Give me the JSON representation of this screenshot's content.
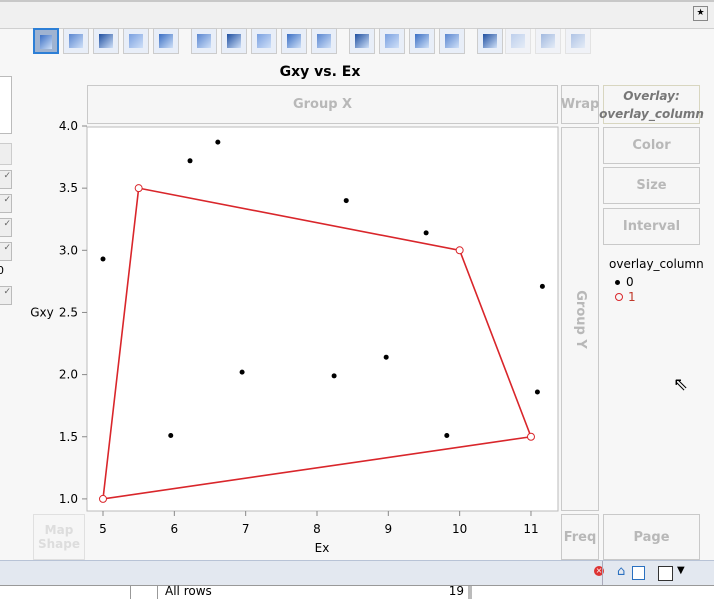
{
  "window": {
    "pin_icon": "pin-icon"
  },
  "toolbar": {
    "icons": [
      "points",
      "smoother",
      "line-of-fit",
      "ellipse",
      "contour",
      "line",
      "bar",
      "area",
      "box-plot",
      "histogram",
      "heatmap",
      "pie",
      "treemap",
      "mosaic",
      "caption-box",
      "formula",
      "map-shapes",
      "parallel"
    ]
  },
  "title": "Gxy vs. Ex",
  "zones": {
    "group_x": "Group X",
    "wrap": "Wrap",
    "overlay": "Overlay:",
    "overlay_col": "overlay_column",
    "color": "Color",
    "size": "Size",
    "interval": "Interval",
    "group_y": "Group Y",
    "map_shape_1": "Map",
    "map_shape_2": "Shape",
    "freq": "Freq",
    "page": "Page"
  },
  "left_panel": {
    "stray_text": "0"
  },
  "legend": {
    "title": "overlay_column",
    "items": [
      {
        "label": "0",
        "color": "#000000"
      },
      {
        "label": "1",
        "color": "#d9262b"
      }
    ]
  },
  "chart_data": {
    "type": "scatter",
    "title": "Gxy vs. Ex",
    "xlabel": "Ex",
    "ylabel": "Gxy",
    "xlim": [
      4.8,
      11.3
    ],
    "ylim": [
      0.9,
      4.02
    ],
    "xticks": [
      "5",
      "6",
      "7",
      "8",
      "9",
      "10",
      "11"
    ],
    "yticks": [
      "1.0",
      "1.5",
      "2.0",
      "2.5",
      "3.0",
      "3.5",
      "4.0"
    ],
    "series": [
      {
        "name": "0",
        "marker": "filled-circle",
        "color": "#000000",
        "points": [
          [
            6.61,
            3.87
          ],
          [
            6.22,
            3.72
          ],
          [
            8.41,
            3.4
          ],
          [
            9.53,
            3.14
          ],
          [
            5.0,
            2.93
          ],
          [
            11.16,
            2.71
          ],
          [
            8.97,
            2.14
          ],
          [
            6.95,
            2.02
          ],
          [
            8.24,
            1.99
          ],
          [
            5.95,
            1.51
          ],
          [
            9.82,
            1.51
          ],
          [
            11.09,
            1.86
          ]
        ]
      },
      {
        "name": "1",
        "marker": "open-circle",
        "color": "#d9262b",
        "connected": "closed-polygon",
        "points": [
          [
            5.5,
            3.5
          ],
          [
            10,
            3.0
          ],
          [
            11,
            1.5
          ],
          [
            5,
            1.0
          ]
        ]
      }
    ]
  },
  "status": {
    "rows_label": "All rows",
    "rows_count": "19"
  }
}
